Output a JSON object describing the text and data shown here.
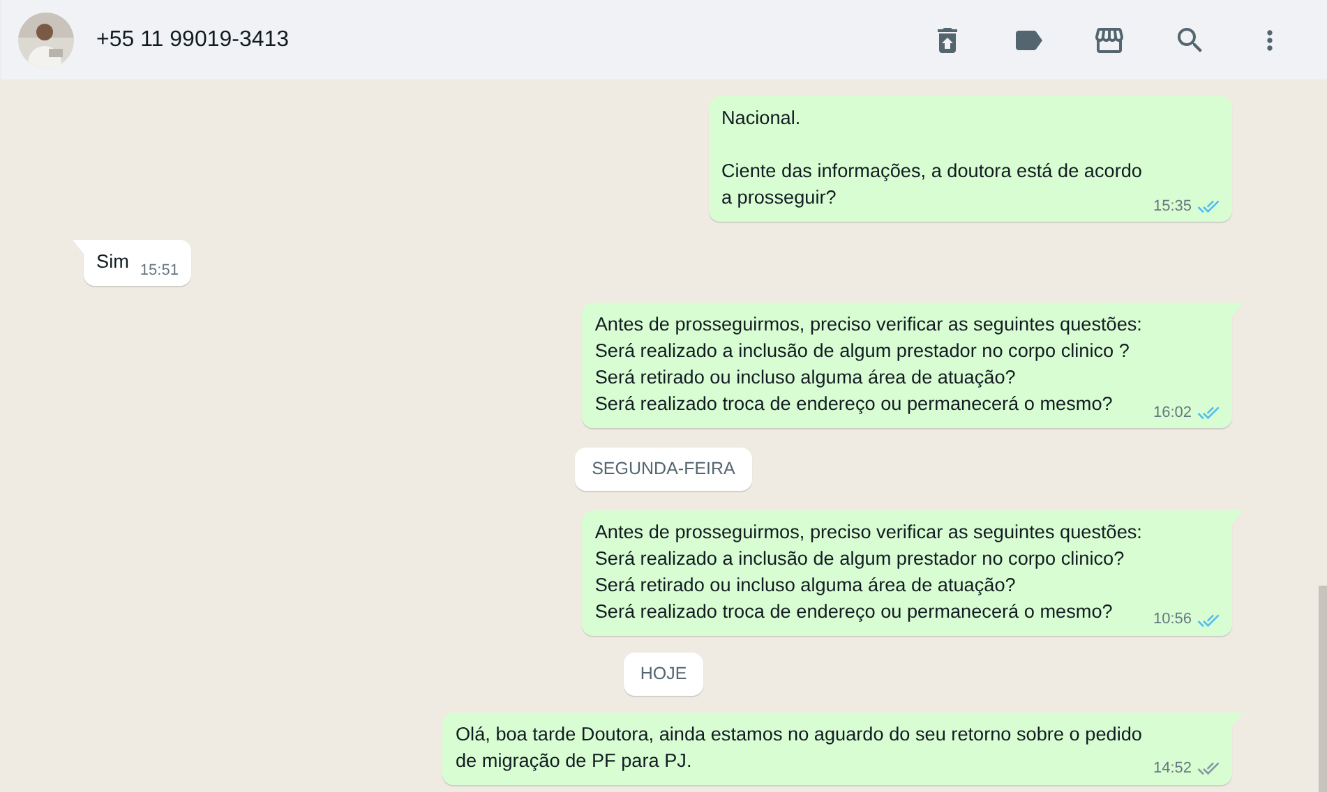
{
  "header": {
    "contact": "+55 11 99019-3413"
  },
  "messages": [
    {
      "kind": "outgoing",
      "text": "Nacional.\n\nCiente das informações, a doutora está de acordo\na prosseguir?",
      "time": "15:35",
      "read": true,
      "tail": false
    },
    {
      "kind": "incoming",
      "text": "Sim",
      "time": "15:51",
      "tail": true
    },
    {
      "kind": "outgoing",
      "text": "Antes de prosseguirmos, preciso verificar as seguintes questões:\nSerá realizado a inclusão de algum prestador no corpo clinico ?\nSerá retirado ou incluso alguma área de atuação?\nSerá realizado troca de endereço ou permanecerá o mesmo?",
      "time": "16:02",
      "read": true,
      "tail": true
    },
    {
      "kind": "date",
      "text": "SEGUNDA-FEIRA"
    },
    {
      "kind": "outgoing",
      "text": "Antes de prosseguirmos, preciso verificar as seguintes questões:\nSerá realizado a inclusão de algum prestador no corpo clinico?\nSerá retirado ou incluso alguma área de atuação?\nSerá realizado troca de endereço ou permanecerá o mesmo?",
      "time": "10:56",
      "read": true,
      "tail": true
    },
    {
      "kind": "date",
      "text": "HOJE"
    },
    {
      "kind": "outgoing",
      "text": "Olá, boa tarde Doutora, ainda estamos no aguardo do seu retorno sobre o pedido\nde migração de PF para PJ.",
      "time": "14:52",
      "read": false,
      "tail": true
    }
  ]
}
